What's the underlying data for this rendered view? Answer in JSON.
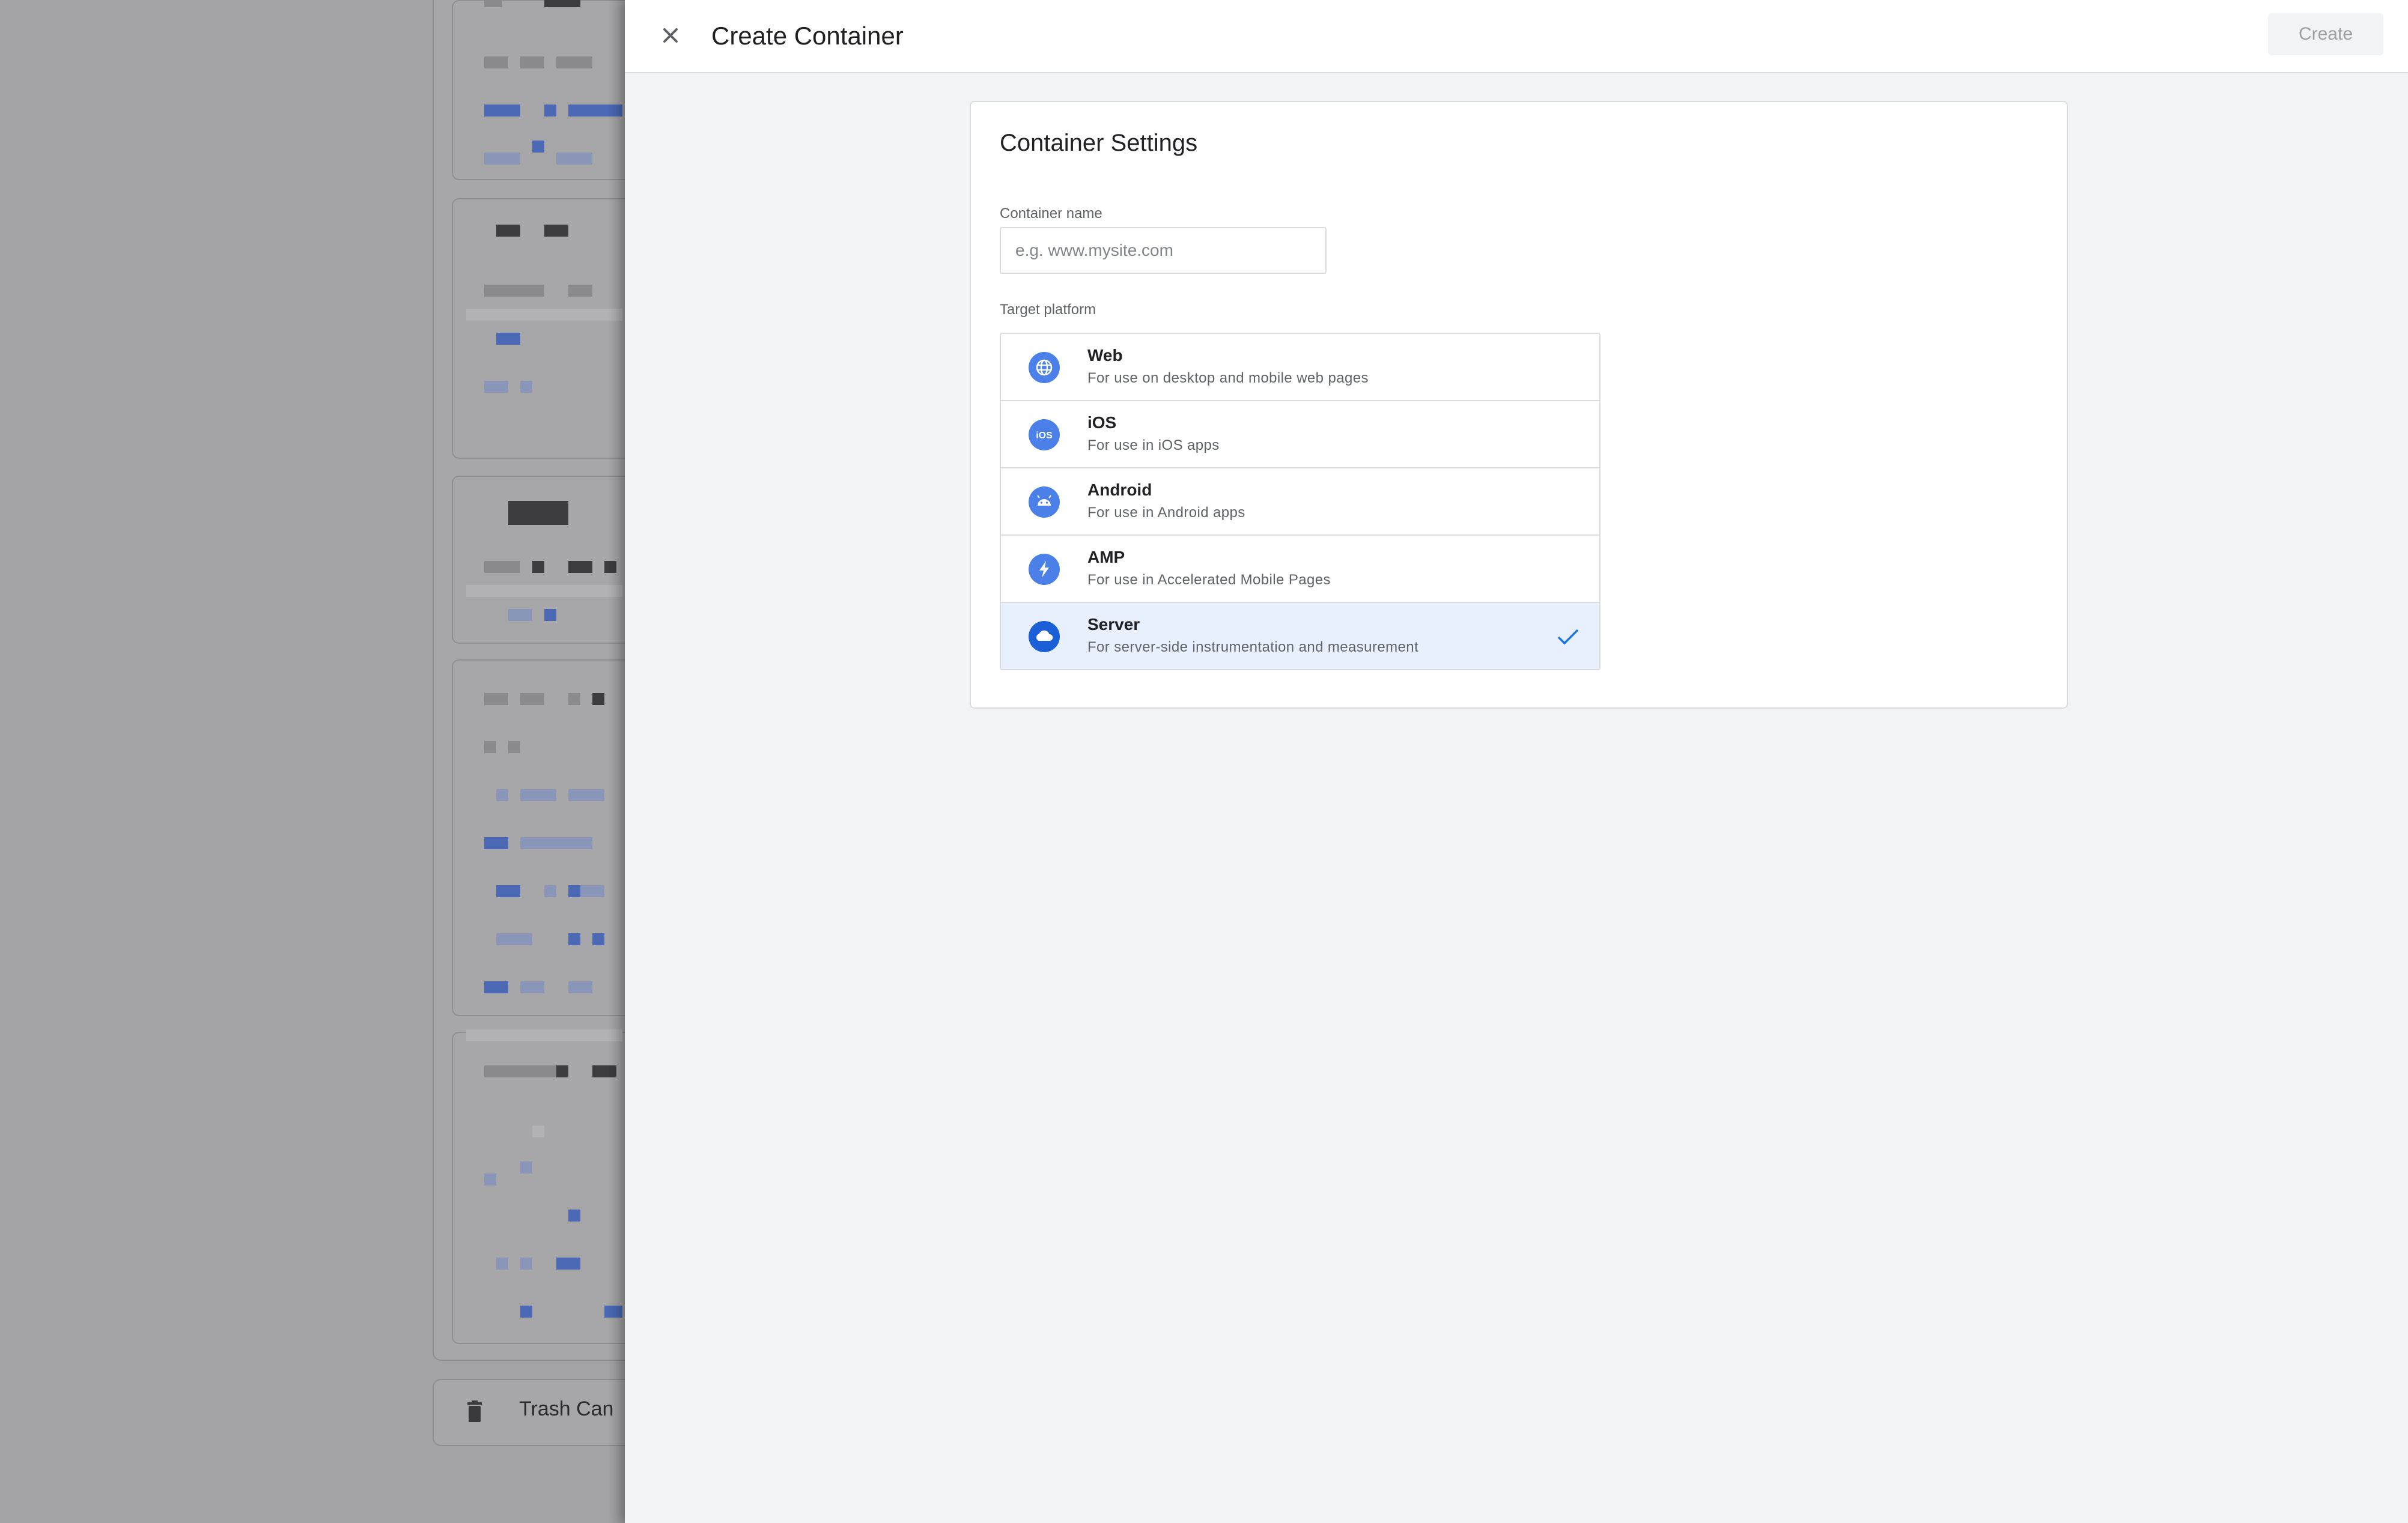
{
  "background": {
    "trash_can_label": "Trash Can"
  },
  "panel": {
    "title": "Create Container",
    "create_button_label": "Create"
  },
  "container_settings": {
    "title": "Container Settings",
    "container_name": {
      "label": "Container name",
      "placeholder": "e.g. www.mysite.com",
      "value": ""
    },
    "target_platform": {
      "label": "Target platform",
      "selected": "Server",
      "options": [
        {
          "name": "Web",
          "description": "For use on desktop and mobile web pages",
          "icon": "globe-icon"
        },
        {
          "name": "iOS",
          "description": "For use in iOS apps",
          "icon": "ios-icon"
        },
        {
          "name": "Android",
          "description": "For use in Android apps",
          "icon": "android-icon"
        },
        {
          "name": "AMP",
          "description": "For use in Accelerated Mobile Pages",
          "icon": "lightning-icon"
        },
        {
          "name": "Server",
          "description": "For server-side instrumentation and measurement",
          "icon": "cloud-icon"
        }
      ]
    }
  },
  "colors": {
    "accent": "#1a73e8",
    "icon_fill": "#4a80e8",
    "selected_row": "#e8f0fe"
  }
}
